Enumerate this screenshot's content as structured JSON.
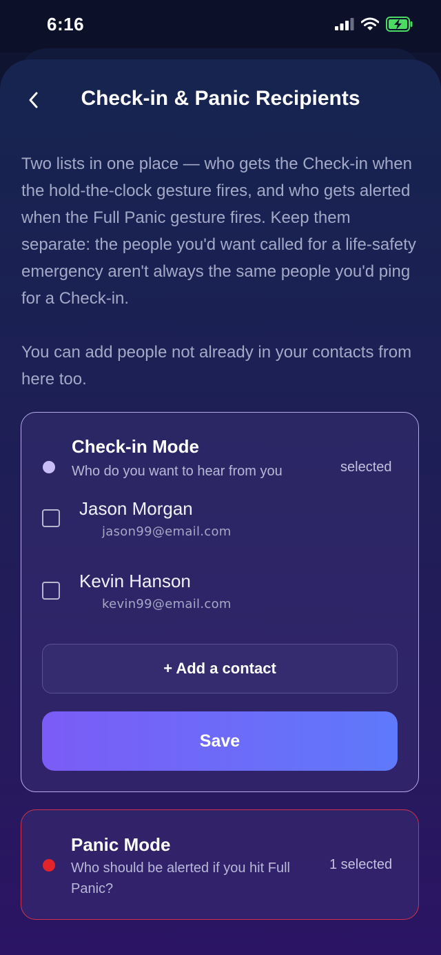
{
  "status_bar": {
    "time": "6:16"
  },
  "header": {
    "title": "Check-in & Panic Recipients"
  },
  "intro": {
    "paragraph_1": "Two lists in one place — who gets the Check-in when the hold-the-clock gesture fires, and who gets alerted when the Full Panic gesture fires. Keep them separate: the people you'd want called for a life-safety emergency aren't always the same people you'd ping for a Check-in.",
    "paragraph_2": "You can add people not already in your contacts from here too."
  },
  "checkin_card": {
    "title": "Check-in Mode",
    "subtitle": "Who do you want to hear from you",
    "selected_label": "selected",
    "accent_color": "#c9bdf7",
    "contacts": [
      {
        "name": "Jason Morgan",
        "email": "jason99@email.com",
        "checked": false
      },
      {
        "name": "Kevin Hanson",
        "email": "kevin99@email.com",
        "checked": false
      }
    ],
    "add_contact_label": "+ Add a contact",
    "save_label": "Save"
  },
  "panic_card": {
    "title": "Panic Mode",
    "subtitle": "Who should be alerted if you hit Full Panic?",
    "selected_label": "1 selected",
    "accent_color": "#e3242b"
  }
}
